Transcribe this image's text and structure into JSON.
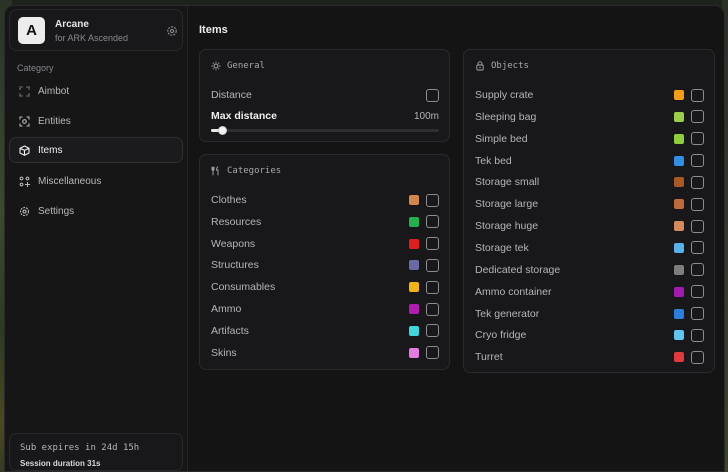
{
  "brand": {
    "logo_letter": "A",
    "name": "Arcane",
    "subtitle": "for ARK Ascended"
  },
  "sidebar": {
    "category_label": "Category",
    "items": [
      {
        "label": "Aimbot",
        "icon": "crosshair-icon"
      },
      {
        "label": "Entities",
        "icon": "entities-icon"
      },
      {
        "label": "Items",
        "icon": "box-icon",
        "active": true
      },
      {
        "label": "Miscellaneous",
        "icon": "misc-icon"
      },
      {
        "label": "Settings",
        "icon": "gear-icon"
      }
    ]
  },
  "session": {
    "sub_expires": "Sub expires in 24d 15h",
    "duration": "Session duration 31s"
  },
  "main": {
    "title": "Items",
    "general": {
      "title": "General",
      "distance_label": "Distance",
      "distance_checked": false,
      "max_distance_label": "Max distance",
      "max_distance_value": "100m",
      "slider_fraction": 0.05
    },
    "categories": {
      "title": "Categories",
      "items": [
        {
          "label": "Clothes",
          "color": "#d3864a"
        },
        {
          "label": "Resources",
          "color": "#22b14c"
        },
        {
          "label": "Weapons",
          "color": "#e01e1e"
        },
        {
          "label": "Structures",
          "color": "#6a6aa6"
        },
        {
          "label": "Consumables",
          "color": "#f2b413"
        },
        {
          "label": "Ammo",
          "color": "#b31cb3"
        },
        {
          "label": "Artifacts",
          "color": "#3ed8dc"
        },
        {
          "label": "Skins",
          "color": "#e57be5"
        }
      ]
    },
    "objects": {
      "title": "Objects",
      "items": [
        {
          "label": "Supply crate",
          "color": "#f49c12"
        },
        {
          "label": "Sleeping bag",
          "color": "#9acd48"
        },
        {
          "label": "Simple bed",
          "color": "#8ccf3a"
        },
        {
          "label": "Tek bed",
          "color": "#2f8ee6"
        },
        {
          "label": "Storage small",
          "color": "#a75a22"
        },
        {
          "label": "Storage large",
          "color": "#c06a3a"
        },
        {
          "label": "Storage huge",
          "color": "#d68a5a"
        },
        {
          "label": "Storage tek",
          "color": "#56b4ea"
        },
        {
          "label": "Dedicated storage",
          "color": "#7d7d7d"
        },
        {
          "label": "Ammo container",
          "color": "#a21ab0"
        },
        {
          "label": "Tek generator",
          "color": "#2a7fdc"
        },
        {
          "label": "Cryo fridge",
          "color": "#5ec6f0"
        },
        {
          "label": "Turret",
          "color": "#e23a3a"
        }
      ]
    }
  }
}
